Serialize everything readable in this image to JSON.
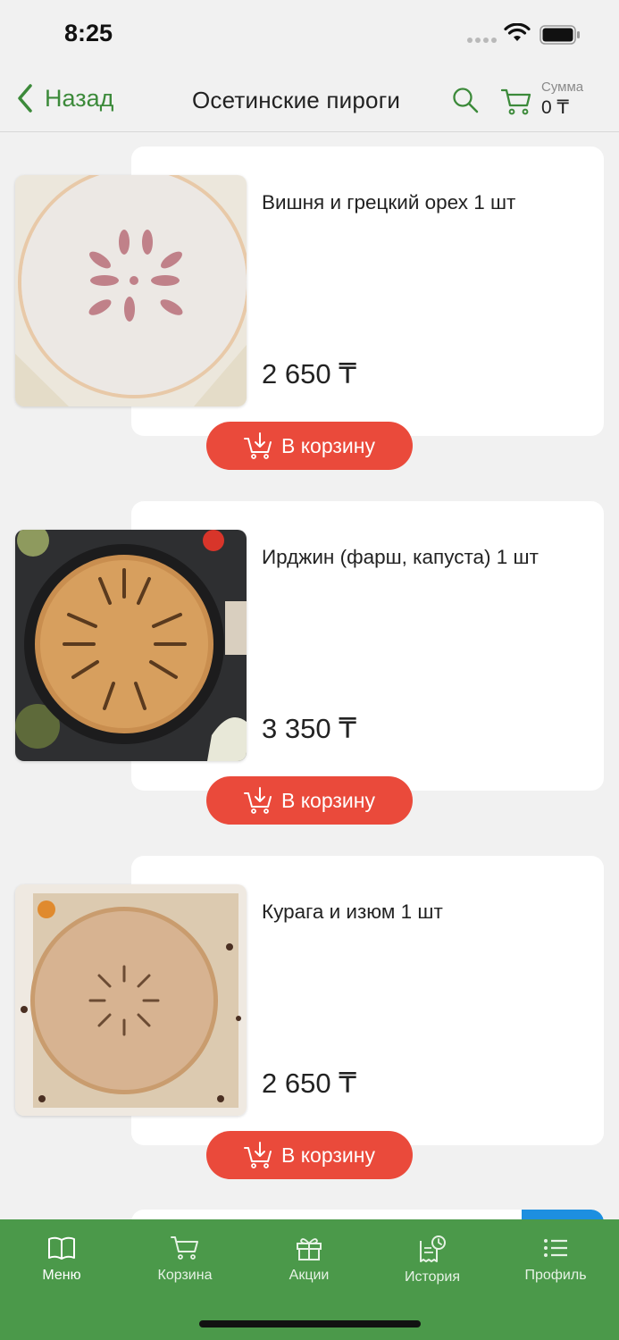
{
  "status_bar": {
    "time": "8:25"
  },
  "header": {
    "back_label": "Назад",
    "title": "Осетинские пироги",
    "sum_label": "Сумма",
    "sum_value": "0 ₸"
  },
  "products": [
    {
      "name": "Вишня и грецкий орех 1 шт",
      "price": "2 650 ₸",
      "button_label": "В корзину"
    },
    {
      "name": "Ирджин (фарш, капуста) 1 шт",
      "price": "3 350 ₸",
      "button_label": "В корзину"
    },
    {
      "name": "Курага и изюм 1 шт",
      "price": "2 650 ₸",
      "button_label": "В корзину"
    }
  ],
  "tabs": [
    {
      "label": "Меню",
      "icon": "book-icon",
      "active": true
    },
    {
      "label": "Корзина",
      "icon": "cart-icon",
      "active": false
    },
    {
      "label": "Акции",
      "icon": "gift-icon",
      "active": false
    },
    {
      "label": "История",
      "icon": "receipt-clock-icon",
      "active": false
    },
    {
      "label": "Профиль",
      "icon": "list-icon",
      "active": false
    }
  ],
  "colors": {
    "accent_green": "#3c8a3a",
    "tab_bar": "#4b994a",
    "add_button": "#ea4a3b"
  }
}
